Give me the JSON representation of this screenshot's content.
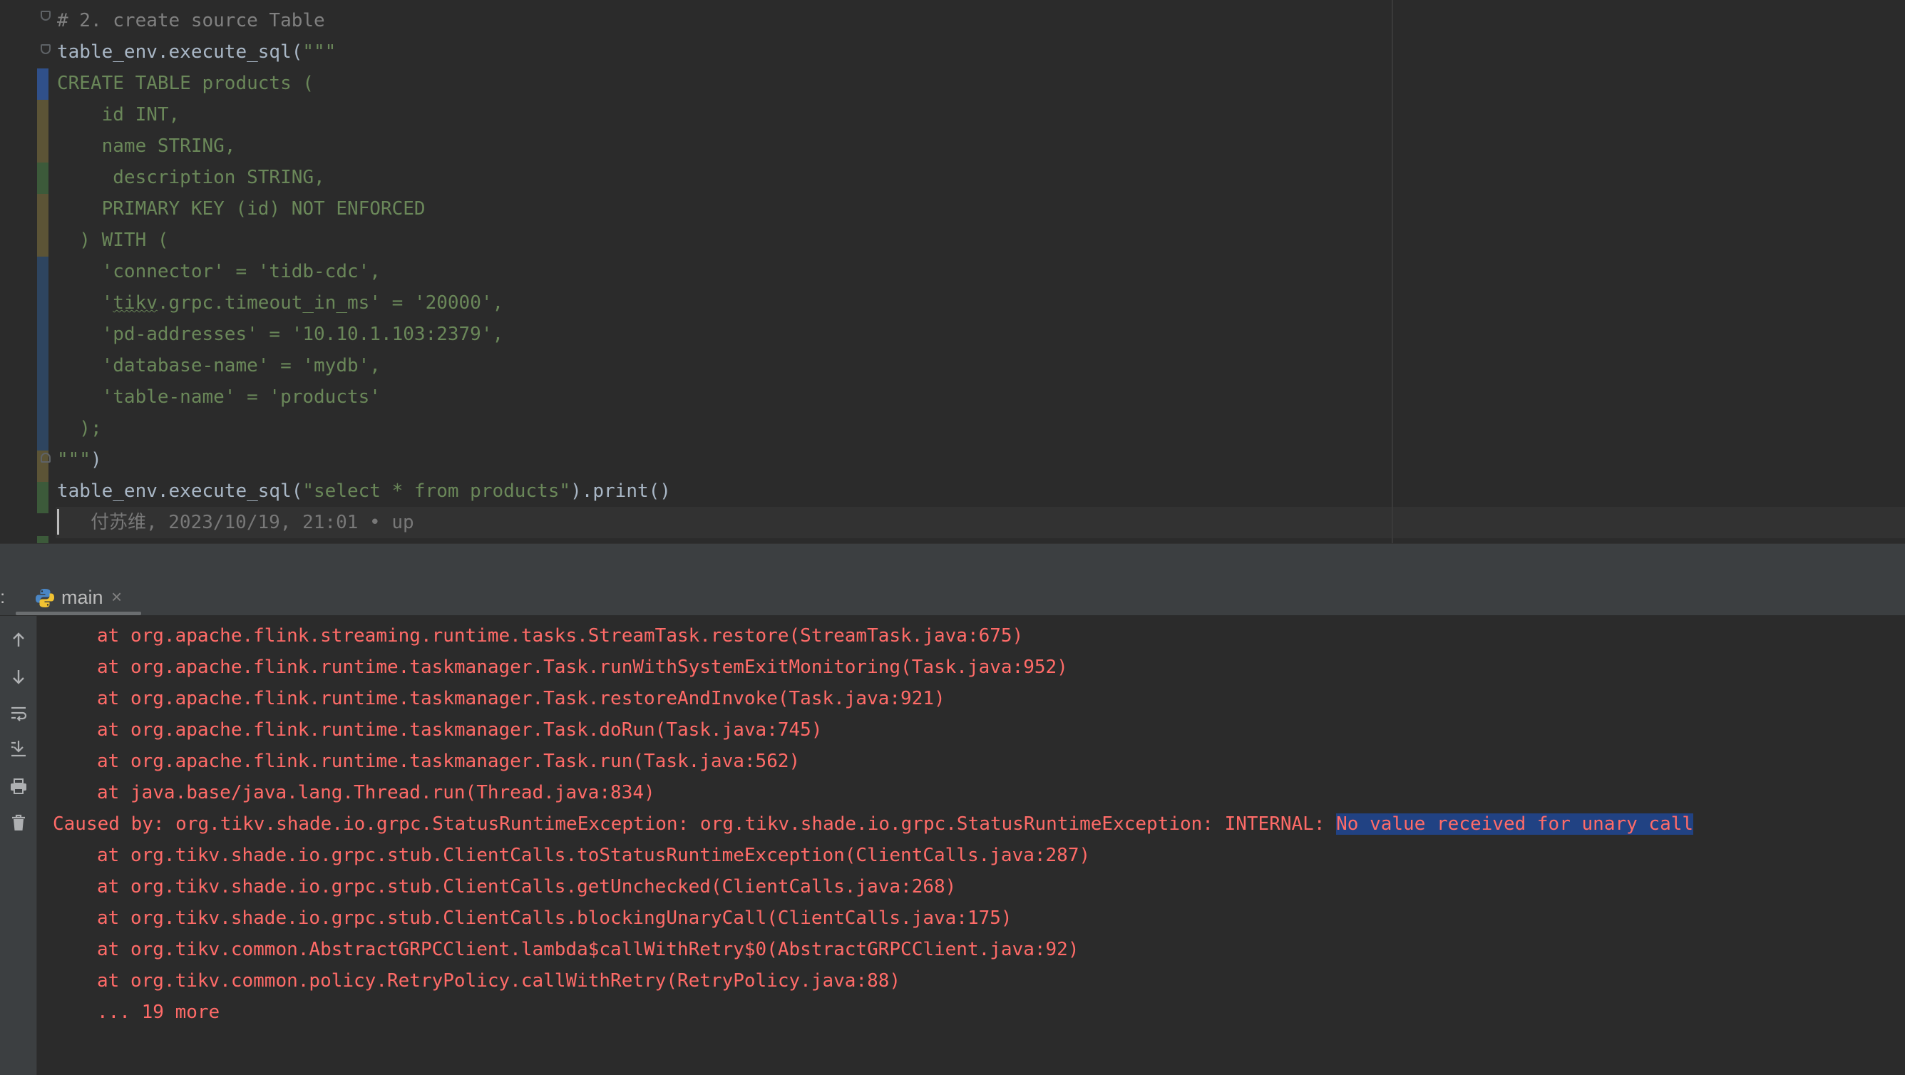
{
  "editor": {
    "lines": [
      {
        "segments": [
          {
            "text": "# 2. create source Table",
            "cls": "c-comment"
          }
        ]
      },
      {
        "segments": [
          {
            "text": "table_env.execute_sql(",
            "cls": "c-default"
          },
          {
            "text": "\"\"\"",
            "cls": "c-string"
          }
        ]
      },
      {
        "segments": [
          {
            "text": "CREATE TABLE products (",
            "cls": "c-string"
          }
        ]
      },
      {
        "segments": [
          {
            "text": "    id INT,",
            "cls": "c-string"
          }
        ]
      },
      {
        "segments": [
          {
            "text": "    name STRING,",
            "cls": "c-string"
          }
        ]
      },
      {
        "segments": [
          {
            "text": "     description STRING,",
            "cls": "c-string"
          }
        ]
      },
      {
        "segments": [
          {
            "text": "    PRIMARY KEY (id) NOT ENFORCED",
            "cls": "c-string"
          }
        ]
      },
      {
        "segments": [
          {
            "text": "  ) WITH (",
            "cls": "c-string"
          }
        ]
      },
      {
        "segments": [
          {
            "text": "    'connector' = 'tidb-cdc',",
            "cls": "c-string"
          }
        ]
      },
      {
        "segments": [
          {
            "text": "    '",
            "cls": "c-string"
          },
          {
            "text": "tikv",
            "cls": "c-string squiggle"
          },
          {
            "text": ".grpc.timeout_in_ms' = '20000',",
            "cls": "c-string"
          }
        ]
      },
      {
        "segments": [
          {
            "text": "    'pd-addresses' = '10.10.1.103:2379',",
            "cls": "c-string"
          }
        ]
      },
      {
        "segments": [
          {
            "text": "    'database-name' = 'mydb',",
            "cls": "c-string"
          }
        ]
      },
      {
        "segments": [
          {
            "text": "    'table-name' = 'products'",
            "cls": "c-string"
          }
        ]
      },
      {
        "segments": [
          {
            "text": "  );",
            "cls": "c-string"
          }
        ]
      },
      {
        "segments": [
          {
            "text": "\"\"\"",
            "cls": "c-string"
          },
          {
            "text": ")",
            "cls": "c-default"
          }
        ]
      },
      {
        "segments": [
          {
            "text": "table_env.execute_sql(",
            "cls": "c-default"
          },
          {
            "text": "\"select * from products\"",
            "cls": "c-string"
          },
          {
            "text": ").print()",
            "cls": "c-default"
          }
        ]
      },
      {
        "segments": [
          {
            "text": "   付苏维, 2023/10/19, 21:01 • up",
            "cls": "c-blame"
          }
        ]
      }
    ]
  },
  "run_panel": {
    "colon": ":",
    "tab_label": "main",
    "close_glyph": "×",
    "toolbar_icons": [
      "up-arrow-icon",
      "down-arrow-icon",
      "soft-wrap-icon",
      "scroll-to-end-icon",
      "print-icon",
      "trash-icon"
    ]
  },
  "console": {
    "lines": [
      {
        "indent": true,
        "text": "at org.apache.flink.streaming.runtime.tasks.StreamTask.restore(StreamTask.java:675)"
      },
      {
        "indent": true,
        "text": "at org.apache.flink.runtime.taskmanager.Task.runWithSystemExitMonitoring(Task.java:952)"
      },
      {
        "indent": true,
        "text": "at org.apache.flink.runtime.taskmanager.Task.restoreAndInvoke(Task.java:921)"
      },
      {
        "indent": true,
        "text": "at org.apache.flink.runtime.taskmanager.Task.doRun(Task.java:745)"
      },
      {
        "indent": true,
        "text": "at org.apache.flink.runtime.taskmanager.Task.run(Task.java:562)"
      },
      {
        "indent": true,
        "text": "at java.base/java.lang.Thread.run(Thread.java:834)"
      },
      {
        "indent": false,
        "text": "Caused by: org.tikv.shade.io.grpc.StatusRuntimeException: org.tikv.shade.io.grpc.StatusRuntimeException: INTERNAL: ",
        "selected": "No value received for unary call"
      },
      {
        "indent": true,
        "text": "at org.tikv.shade.io.grpc.stub.ClientCalls.toStatusRuntimeException(ClientCalls.java:287)"
      },
      {
        "indent": true,
        "text": "at org.tikv.shade.io.grpc.stub.ClientCalls.getUnchecked(ClientCalls.java:268)"
      },
      {
        "indent": true,
        "text": "at org.tikv.shade.io.grpc.stub.ClientCalls.blockingUnaryCall(ClientCalls.java:175)"
      },
      {
        "indent": true,
        "text": "at org.tikv.common.AbstractGRPCClient.lambda$callWithRetry$0(AbstractGRPCClient.java:92)"
      },
      {
        "indent": true,
        "text": "at org.tikv.common.policy.RetryPolicy.callWithRetry(RetryPolicy.java:88)"
      },
      {
        "indent": true,
        "text": "... 19 more"
      }
    ]
  },
  "colors": {
    "editor_bg": "#2b2b2b",
    "string": "#6a8759",
    "comment": "#808080",
    "error_text": "#ff6b68",
    "selection": "#214283"
  }
}
